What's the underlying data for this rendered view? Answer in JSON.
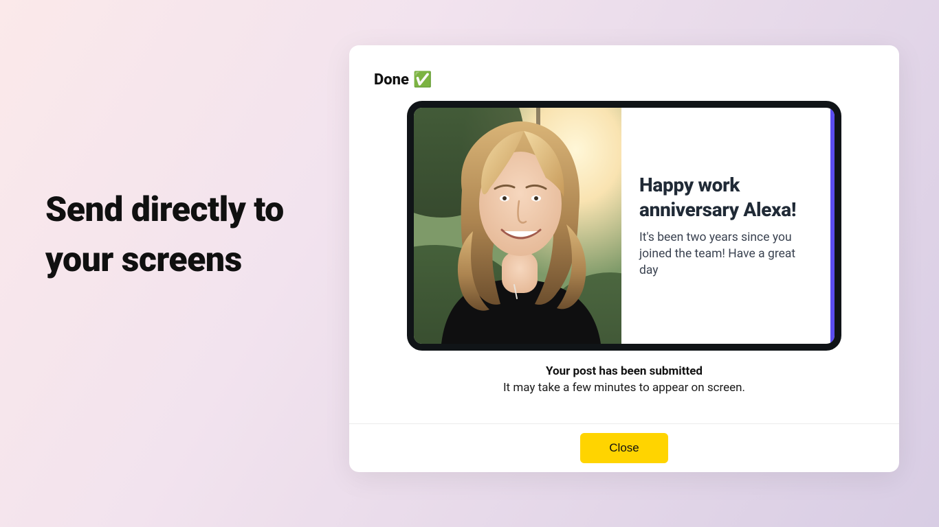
{
  "hero": {
    "headline": "Send directly to your screens"
  },
  "modal": {
    "done_label": "Done",
    "done_emoji": "✅",
    "preview": {
      "title": "Happy work anniversary Alexa!",
      "body": "It's been two years since you joined the team! Have a great day"
    },
    "status": {
      "headline": "Your post has been submitted",
      "sub": "It may take a few minutes to appear on screen."
    },
    "close_label": "Close"
  }
}
